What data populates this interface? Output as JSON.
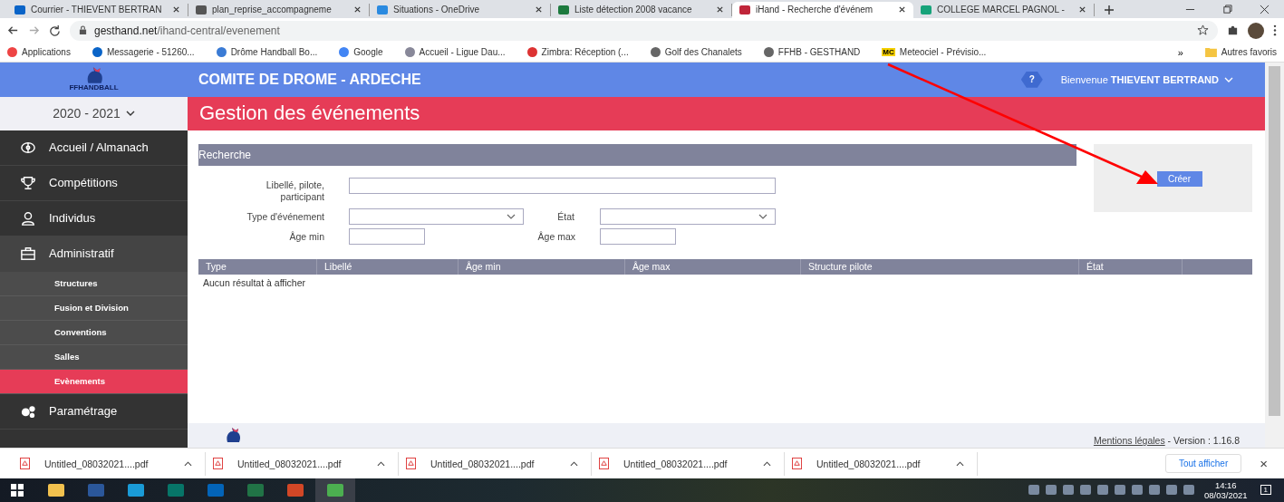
{
  "browser": {
    "tabs": [
      {
        "title": "Courrier - THIEVENT BERTRAN",
        "selected": false
      },
      {
        "title": "plan_reprise_accompagneme",
        "selected": false
      },
      {
        "title": "Situations - OneDrive",
        "selected": false
      },
      {
        "title": "Liste détection 2008 vacance",
        "selected": false
      },
      {
        "title": "iHand - Recherche d'événem",
        "selected": true
      },
      {
        "title": "COLLEGE MARCEL PAGNOL -",
        "selected": false
      }
    ],
    "address": {
      "host": "gesthand.net",
      "path": "/ihand-central/evenement"
    },
    "bookmarks": [
      {
        "label": "Applications"
      },
      {
        "label": "Messagerie - 51260..."
      },
      {
        "label": "Drôme Handball Bo..."
      },
      {
        "label": "Google"
      },
      {
        "label": "Accueil - Ligue Dau..."
      },
      {
        "label": "Zimbra: Réception (..."
      },
      {
        "label": "Golf des Chanalets"
      },
      {
        "label": "FFHB - GESTHAND"
      },
      {
        "label": "Meteociel - Prévisio...",
        "badge": "MC"
      }
    ],
    "bookmarks_more": "»",
    "other_bookmarks": "Autres favoris"
  },
  "header": {
    "logo_text": "FFHANDBALL",
    "title": "COMITE DE DROME - ARDECHE",
    "help": "?",
    "welcome": "Bienvenue **THIEVENT BERTRAND**"
  },
  "season": "2020 - 2021",
  "sidebar": {
    "items": [
      {
        "label": "Accueil / Almanach",
        "selected": false
      },
      {
        "label": "Compétitions",
        "selected": false
      },
      {
        "label": "Individus",
        "selected": false
      },
      {
        "label": "Administratif",
        "selected": false,
        "expanded": true,
        "children": [
          {
            "label": "Structures",
            "selected": false
          },
          {
            "label": "Fusion et Division",
            "selected": false
          },
          {
            "label": "Conventions",
            "selected": false
          },
          {
            "label": "Salles",
            "selected": false
          },
          {
            "label": "Evènements",
            "selected": true
          }
        ]
      },
      {
        "label": "Paramétrage",
        "selected": false
      }
    ]
  },
  "page_title": "Gestion des événements",
  "search": {
    "title": "Recherche",
    "fields": [
      {
        "label": "Libellé, pilote, participant",
        "kind": "text"
      },
      {
        "label": "Type d'événement",
        "kind": "select"
      },
      {
        "label": "État",
        "kind": "select"
      },
      {
        "label": "Âge min",
        "kind": "text"
      },
      {
        "label": "Âge max",
        "kind": "text"
      }
    ]
  },
  "create_button": "Créer",
  "table": {
    "columns": [
      "Type",
      "Libellé",
      "Âge min",
      "Âge max",
      "Structure pilote",
      "État"
    ],
    "empty_message": "Aucun résultat à afficher"
  },
  "footer": {
    "legal_link": "Mentions légales",
    "version": " - Version : 1.16.8"
  },
  "downloads": {
    "items": [
      "Untitled_08032021....pdf",
      "Untitled_08032021....pdf",
      "Untitled_08032021....pdf",
      "Untitled_08032021....pdf",
      "Untitled_08032021....pdf"
    ],
    "show_all": "Tout afficher",
    "close": "×"
  },
  "taskbar": {
    "time": "14:16",
    "date": "08/03/2021",
    "notifications": "1"
  }
}
